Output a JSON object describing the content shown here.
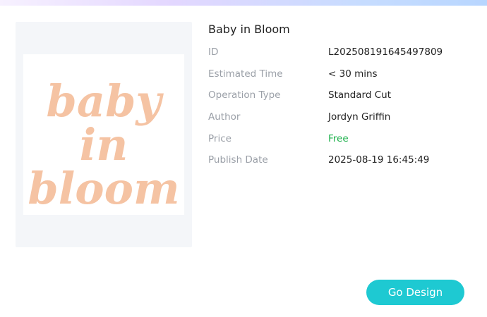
{
  "product": {
    "title": "Baby in Bloom",
    "image_text": [
      "baby",
      "in",
      "bloom"
    ],
    "image_text_color": "#f5c3a3",
    "details": [
      {
        "label": "ID",
        "value": "L202508191645497809"
      },
      {
        "label": "Estimated Time",
        "value": "< 30 mins"
      },
      {
        "label": "Operation Type",
        "value": "Standard Cut"
      },
      {
        "label": "Author",
        "value": "Jordyn Griffin"
      },
      {
        "label": "Price",
        "value": "Free",
        "value_color": "#1bb04a"
      },
      {
        "label": "Publish Date",
        "value": "2025-08-19 16:45:49"
      }
    ]
  },
  "actions": {
    "go_design_label": "Go Design",
    "go_design_color": "#1ec9d2"
  },
  "header": {
    "gradient": [
      "#f7f1ff",
      "#e3d7ff",
      "#c6dcff",
      "#b8d6ff"
    ]
  }
}
